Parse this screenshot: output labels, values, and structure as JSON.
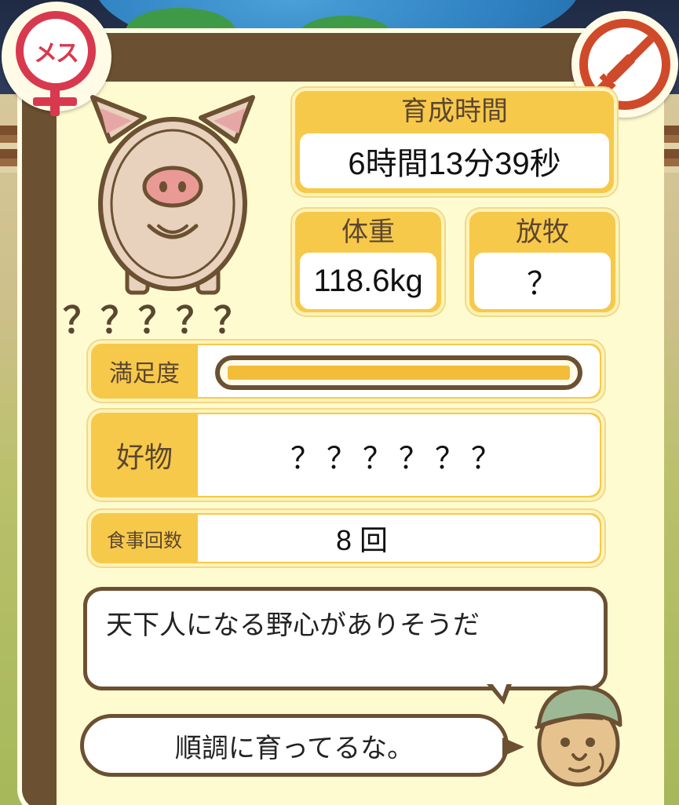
{
  "pig": {
    "name": "？？？？？",
    "gender_label": "メス"
  },
  "stats": {
    "raise_time_label": "育成時間",
    "raise_time_value": "6時間13分39秒",
    "weight_label": "体重",
    "weight_value": "118.6kg",
    "grazing_label": "放牧",
    "grazing_value": "？",
    "satisfaction_label": "満足度",
    "satisfaction_level": 1.0,
    "favorite_label": "好物",
    "favorite_value": "？？？？？？",
    "meal_count_label": "食事回数",
    "meal_count_value": "8 回"
  },
  "dialogue": {
    "comment": "天下人になる野心がありそうだ",
    "status": "順調に育ってるな。"
  },
  "icons": {
    "gender": "female-icon",
    "injection": "no-injection-icon",
    "farmer": "farmer-avatar"
  },
  "colors": {
    "accent_yellow": "#f7c94a",
    "frame_brown": "#6b5032",
    "female_red": "#d8394f",
    "injection_red": "#cf4a2a"
  }
}
